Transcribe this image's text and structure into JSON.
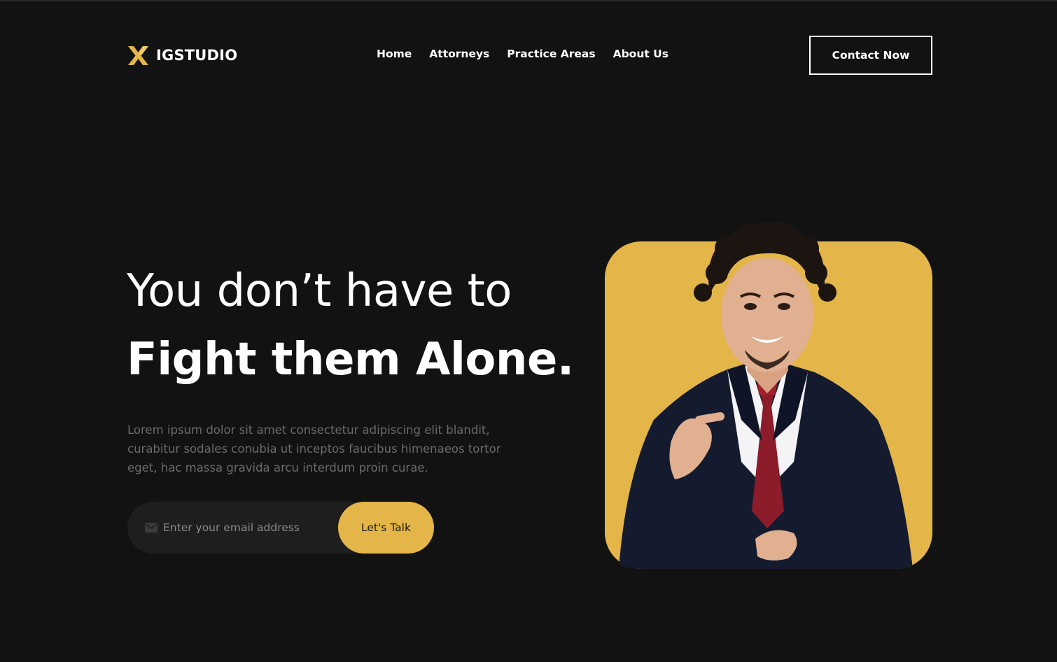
{
  "header": {
    "logo_text": "IGSTUDIO",
    "logo_icon": "x-icon",
    "nav": [
      {
        "label": "Home"
      },
      {
        "label": "Attorneys"
      },
      {
        "label": "Practice Areas"
      },
      {
        "label": "About Us"
      }
    ],
    "cta_label": "Contact Now"
  },
  "hero": {
    "headline_line1": "You don’t have to",
    "headline_line2": "Fight them Alone.",
    "description": "Lorem ipsum dolor sit amet consectetur adipiscing elit blandit, curabitur sodales conubia ut inceptos faucibus himenaeos tortor eget, hac massa gravida arcu interdum proin curae.",
    "email_placeholder": "Enter your email address",
    "email_icon": "mail-icon",
    "submit_label": "Let's Talk",
    "image_subject": "attorney-portrait"
  },
  "colors": {
    "background": "#121212",
    "accent": "#e4b548",
    "text": "#ffffff",
    "muted_text": "#6b6b6b",
    "input_bg": "#1e1e1e"
  }
}
